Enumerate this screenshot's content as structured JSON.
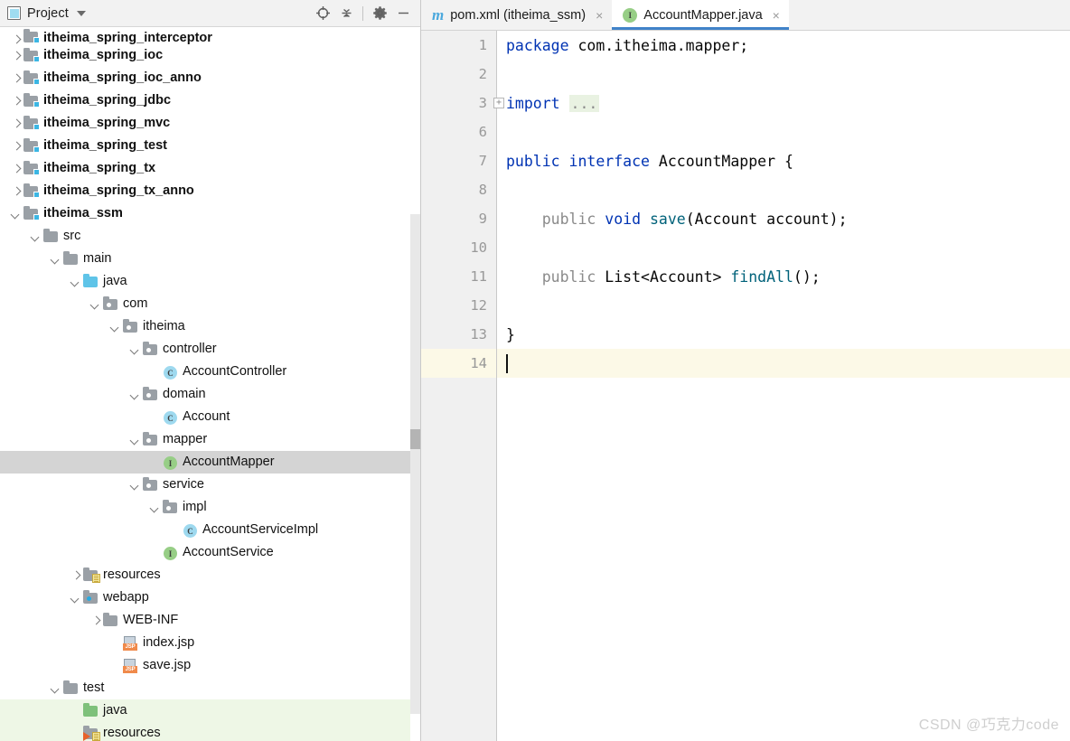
{
  "tool_window": {
    "title": "Project",
    "icons": {
      "project": "project-icon",
      "dropdown": "chevron-down-icon",
      "locate": "locate-target-icon",
      "collapse_all": "collapse-all-icon",
      "settings": "gear-icon",
      "hide": "minimize-icon"
    }
  },
  "tree": {
    "items": [
      {
        "label": "itheima_spring_interceptor",
        "indent": 0,
        "arrow": "closed",
        "icon": "module-folder-icon",
        "bold": true,
        "state": "clipped"
      },
      {
        "label": "itheima_spring_ioc",
        "indent": 0,
        "arrow": "closed",
        "icon": "module-folder-icon",
        "bold": true
      },
      {
        "label": "itheima_spring_ioc_anno",
        "indent": 0,
        "arrow": "closed",
        "icon": "module-folder-icon",
        "bold": true
      },
      {
        "label": "itheima_spring_jdbc",
        "indent": 0,
        "arrow": "closed",
        "icon": "module-folder-icon",
        "bold": true
      },
      {
        "label": "itheima_spring_mvc",
        "indent": 0,
        "arrow": "closed",
        "icon": "module-folder-icon",
        "bold": true
      },
      {
        "label": "itheima_spring_test",
        "indent": 0,
        "arrow": "closed",
        "icon": "module-folder-icon",
        "bold": true
      },
      {
        "label": "itheima_spring_tx",
        "indent": 0,
        "arrow": "closed",
        "icon": "module-folder-icon",
        "bold": true
      },
      {
        "label": "itheima_spring_tx_anno",
        "indent": 0,
        "arrow": "closed",
        "icon": "module-folder-icon",
        "bold": true
      },
      {
        "label": "itheima_ssm",
        "indent": 0,
        "arrow": "open",
        "icon": "module-folder-icon",
        "bold": true
      },
      {
        "label": "src",
        "indent": 1,
        "arrow": "open",
        "icon": "folder-icon"
      },
      {
        "label": "main",
        "indent": 2,
        "arrow": "open",
        "icon": "folder-icon"
      },
      {
        "label": "java",
        "indent": 3,
        "arrow": "open",
        "icon": "source-root-folder-icon"
      },
      {
        "label": "com",
        "indent": 4,
        "arrow": "open",
        "icon": "package-folder-icon"
      },
      {
        "label": "itheima",
        "indent": 5,
        "arrow": "open",
        "icon": "package-folder-icon"
      },
      {
        "label": "controller",
        "indent": 6,
        "arrow": "open",
        "icon": "package-folder-icon"
      },
      {
        "label": "AccountController",
        "indent": 7,
        "arrow": "none",
        "icon": "class-icon"
      },
      {
        "label": "domain",
        "indent": 6,
        "arrow": "open",
        "icon": "package-folder-icon"
      },
      {
        "label": "Account",
        "indent": 7,
        "arrow": "none",
        "icon": "class-icon"
      },
      {
        "label": "mapper",
        "indent": 6,
        "arrow": "open",
        "icon": "package-folder-icon"
      },
      {
        "label": "AccountMapper",
        "indent": 7,
        "arrow": "none",
        "icon": "interface-icon",
        "selected": true
      },
      {
        "label": "service",
        "indent": 6,
        "arrow": "open",
        "icon": "package-folder-icon"
      },
      {
        "label": "impl",
        "indent": 7,
        "arrow": "open",
        "icon": "package-folder-icon"
      },
      {
        "label": "AccountServiceImpl",
        "indent": 8,
        "arrow": "none",
        "icon": "class-icon"
      },
      {
        "label": "AccountService",
        "indent": 7,
        "arrow": "none",
        "icon": "interface-icon"
      },
      {
        "label": "resources",
        "indent": 3,
        "arrow": "closed",
        "icon": "resource-root-folder-icon"
      },
      {
        "label": "webapp",
        "indent": 3,
        "arrow": "open",
        "icon": "web-root-folder-icon"
      },
      {
        "label": "WEB-INF",
        "indent": 4,
        "arrow": "closed",
        "icon": "folder-icon"
      },
      {
        "label": "index.jsp",
        "indent": 5,
        "arrow": "none",
        "icon": "jsp-file-icon"
      },
      {
        "label": "save.jsp",
        "indent": 5,
        "arrow": "none",
        "icon": "jsp-file-icon"
      },
      {
        "label": "test",
        "indent": 2,
        "arrow": "open",
        "icon": "folder-icon"
      },
      {
        "label": "java",
        "indent": 3,
        "arrow": "none",
        "icon": "test-source-root-folder-icon",
        "testroot": true
      },
      {
        "label": "resources",
        "indent": 3,
        "arrow": "none",
        "icon": "test-resource-root-folder-icon",
        "testroot": true
      }
    ]
  },
  "editor": {
    "tabs": [
      {
        "label": "pom.xml (itheima_ssm)",
        "icon": "maven-file-icon",
        "active": false,
        "close": "×"
      },
      {
        "label": "AccountMapper.java",
        "icon": "interface-file-icon",
        "active": true,
        "close": "×"
      }
    ],
    "gutter_numbers": [
      "1",
      "2",
      "3",
      "6",
      "7",
      "8",
      "9",
      "10",
      "11",
      "12",
      "13",
      "14"
    ],
    "caret_line": "14",
    "fold_marker": "+",
    "code_lines": [
      {
        "n": "1",
        "tokens": [
          {
            "t": "package",
            "c": "kw"
          },
          {
            "t": " com.itheima.mapper;",
            "c": "plain"
          }
        ]
      },
      {
        "n": "2",
        "tokens": []
      },
      {
        "n": "3",
        "tokens": [
          {
            "t": "import",
            "c": "kw"
          },
          {
            "t": " ",
            "c": "plain"
          },
          {
            "t": "...",
            "c": "fold"
          }
        ]
      },
      {
        "n": "6",
        "tokens": []
      },
      {
        "n": "7",
        "tokens": [
          {
            "t": "public",
            "c": "kw"
          },
          {
            "t": " ",
            "c": "plain"
          },
          {
            "t": "interface",
            "c": "kw"
          },
          {
            "t": " AccountMapper {",
            "c": "plain"
          }
        ]
      },
      {
        "n": "8",
        "tokens": []
      },
      {
        "n": "9",
        "tokens": [
          {
            "t": "    ",
            "c": "plain"
          },
          {
            "t": "public",
            "c": "kw2"
          },
          {
            "t": " ",
            "c": "plain"
          },
          {
            "t": "void",
            "c": "kw"
          },
          {
            "t": " ",
            "c": "plain"
          },
          {
            "t": "save",
            "c": "mth"
          },
          {
            "t": "(Account account);",
            "c": "plain"
          }
        ]
      },
      {
        "n": "10",
        "tokens": []
      },
      {
        "n": "11",
        "tokens": [
          {
            "t": "    ",
            "c": "plain"
          },
          {
            "t": "public",
            "c": "kw2"
          },
          {
            "t": " List<Account> ",
            "c": "plain"
          },
          {
            "t": "findAll",
            "c": "mth"
          },
          {
            "t": "();",
            "c": "plain"
          }
        ]
      },
      {
        "n": "12",
        "tokens": []
      },
      {
        "n": "13",
        "tokens": [
          {
            "t": "}",
            "c": "plain"
          }
        ]
      },
      {
        "n": "14",
        "tokens": [],
        "caret": true
      }
    ],
    "gutter_run_icon": "implemented-by-marker-icon"
  },
  "watermark": {
    "text": "CSDN @巧克力code",
    "overlay": "巧克力"
  },
  "colors": {
    "accent": "#4083c9",
    "keyword": "#0033b3",
    "method": "#00627a",
    "selection": "#d4d4d4",
    "test_root": "#eef7e6",
    "caret_line": "#fcf9e7"
  }
}
